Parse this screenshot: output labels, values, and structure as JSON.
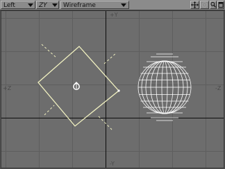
{
  "toolbar": {
    "view_name": "Left",
    "axis_plane": "ZY",
    "render_mode": "Wireframe"
  },
  "icons": [
    "move-icon",
    "rotate-view-icon",
    "zoom-icon",
    "maximize-icon"
  ],
  "viewport": {
    "axis_labels": {
      "top": "+Y",
      "bottom": "-Y",
      "left": "+Z",
      "right": "-Z"
    }
  },
  "colors": {
    "background": "#6d6d6d",
    "grid": "#5e5e5e",
    "axis": "#0c0c0c",
    "selected_wire": "#f0f0c0",
    "mesh": "#ffffff"
  }
}
